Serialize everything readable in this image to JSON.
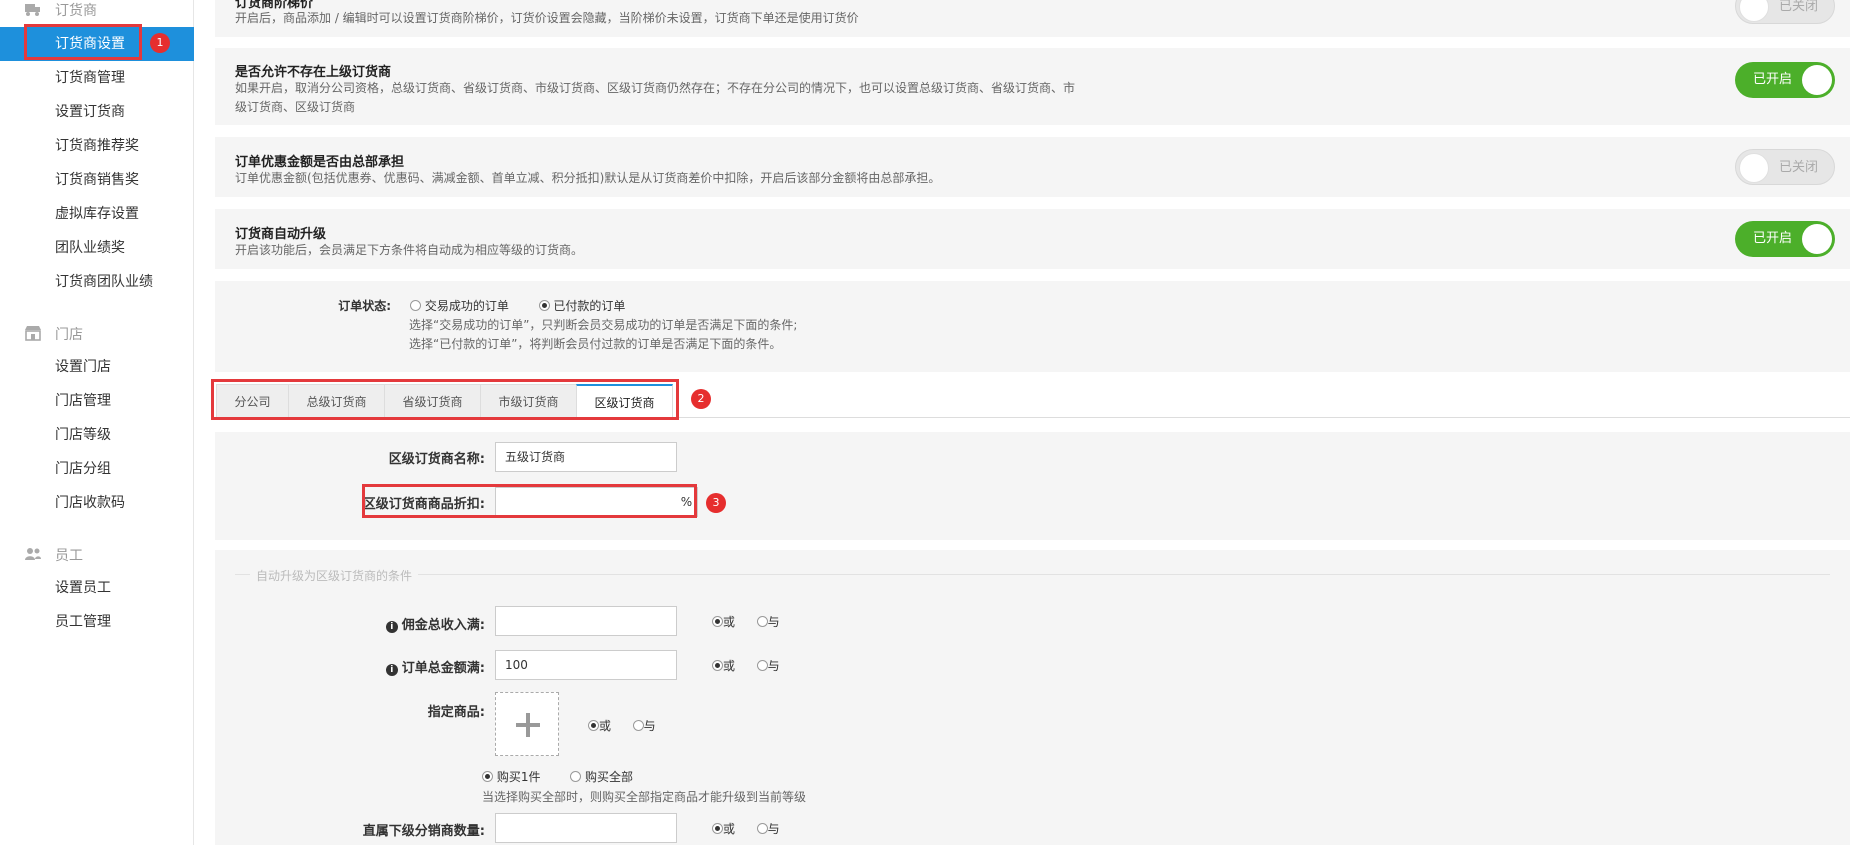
{
  "sidebar": {
    "groups": [
      {
        "label": "订货商",
        "icon": "truck-icon"
      },
      {
        "label": "门店",
        "icon": "store-icon"
      },
      {
        "label": "员工",
        "icon": "users-icon"
      }
    ],
    "items": [
      {
        "label": "订货商设置",
        "active": true
      },
      {
        "label": "订货商管理"
      },
      {
        "label": "设置订货商"
      },
      {
        "label": "订货商推荐奖"
      },
      {
        "label": "订货商销售奖"
      },
      {
        "label": "虚拟库存设置"
      },
      {
        "label": "团队业绩奖"
      },
      {
        "label": "订货商团队业绩"
      },
      {
        "label": "设置门店"
      },
      {
        "label": "门店管理"
      },
      {
        "label": "门店等级"
      },
      {
        "label": "门店分组"
      },
      {
        "label": "门店收款码"
      },
      {
        "label": "设置员工"
      },
      {
        "label": "员工管理"
      }
    ]
  },
  "badges": {
    "one": "1",
    "two": "2",
    "three": "3"
  },
  "settings": [
    {
      "title": "订货商阶梯价",
      "desc": "开启后，商品添加 / 编辑时可以设置订货商阶梯价，订货价设置会隐藏，当阶梯价未设置，订货商下单还是使用订货价",
      "toggle": "已关闭",
      "on": false
    },
    {
      "title": "是否允许不存在上级订货商",
      "desc": "如果开启，取消分公司资格，总级订货商、省级订货商、市级订货商、区级订货商仍然存在；不存在分公司的情况下，也可以设置总级订货商、省级订货商、市级订货商、区级订货商",
      "toggle": "已开启",
      "on": true
    },
    {
      "title": "订单优惠金额是否由总部承担",
      "desc": "订单优惠金额(包括优惠券、优惠码、满减金额、首单立减、积分抵扣)默认是从订货商差价中扣除，开启后该部分金额将由总部承担。",
      "toggle": "已关闭",
      "on": false
    },
    {
      "title": "订货商自动升级",
      "desc": "开启该功能后，会员满足下方条件将自动成为相应等级的订货商。",
      "toggle": "已开启",
      "on": true
    }
  ],
  "order_status": {
    "label": "订单状态:",
    "options": [
      {
        "label": "交易成功的订单",
        "checked": false
      },
      {
        "label": "已付款的订单",
        "checked": true
      }
    ],
    "help1": "选择“交易成功的订单”，只判断会员交易成功的订单是否满足下面的条件;",
    "help2": "选择“已付款的订单”，将判断会员付过款的订单是否满足下面的条件。"
  },
  "tabs": [
    {
      "label": "分公司"
    },
    {
      "label": "总级订货商"
    },
    {
      "label": "省级订货商"
    },
    {
      "label": "市级订货商"
    },
    {
      "label": "区级订货商",
      "active": true
    }
  ],
  "level_form": {
    "name_label": "区级订货商名称:",
    "name_value": "五级订货商",
    "discount_label": "区级订货商商品折扣:",
    "discount_value": "",
    "discount_unit": "%"
  },
  "conditions": {
    "legend": "自动升级为区级订货商的条件",
    "or_label": "或",
    "and_label": "与",
    "commission_label": "佣金总收入满:",
    "commission_value": "",
    "order_total_label": "订单总金额满:",
    "order_total_value": "100",
    "goods_label": "指定商品:",
    "buy_one": "购买1件",
    "buy_all": "购买全部",
    "goods_help": "当选择购买全部时，则购买全部指定商品才能升级到当前等级",
    "direct_label": "直属下级分销商数量:",
    "direct_value": ""
  }
}
